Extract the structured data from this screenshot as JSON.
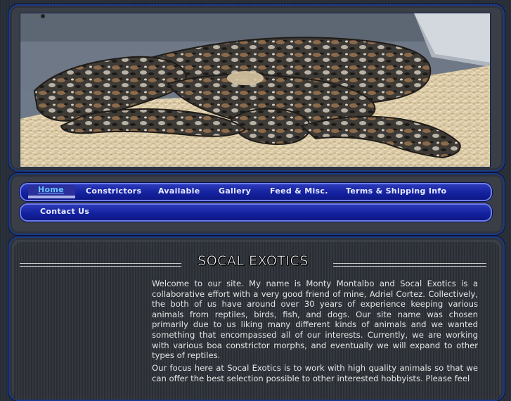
{
  "nav": {
    "row1": [
      "Home",
      "Constrictors",
      "Available",
      "Gallery",
      "Feed & Misc.",
      "Terms & Shipping Info"
    ],
    "row2": [
      "Contact Us"
    ],
    "active": "Home"
  },
  "content": {
    "title": "SOCAL EXOTICS",
    "paragraph1": "Welcome to our site.  My name is Monty Montalbo and Socal Exotics is a collaborative effort with a very good friend of mine, Adriel Cortez.  Collectively, the both of us have around over 30 years of experience keeping various animals from reptiles, birds, fish, and dogs.  Our site name was chosen primarily due to us liking many different kinds of animals and we wanted something that encompassed all of our interests.  Currently, we are working with various boa constrictor morphs, and  eventually we will expand to other types of reptiles.",
    "paragraph2": "Our focus here at Socal Exotics is to work with high quality animals so that we can offer the best selection possible to other interested hobbyists.  Please feel"
  },
  "colors": {
    "nav_bar": "#1422a0",
    "nav_border": "#6e7de8",
    "active_link": "#69c3ff",
    "panel": "#3a3f47",
    "text": "#e4e4e4"
  },
  "banner": {
    "icon": "boa-constrictor-photo"
  }
}
